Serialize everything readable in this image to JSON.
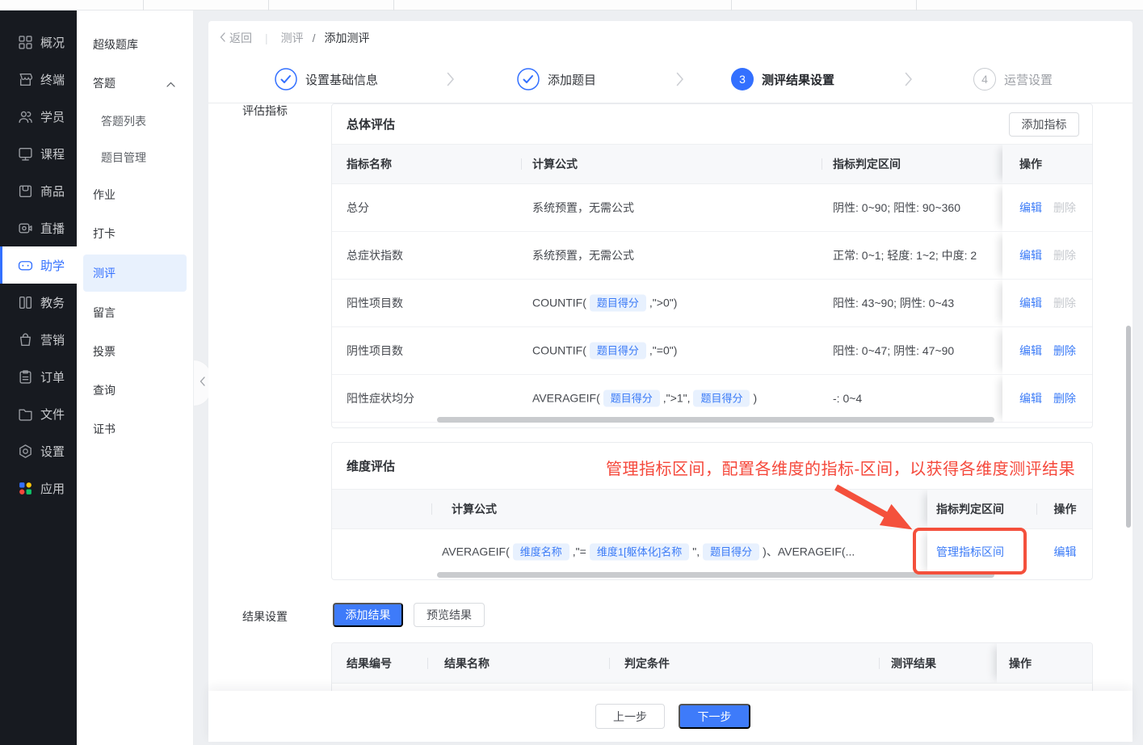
{
  "colors": {
    "accent": "#3370ff",
    "button_blue": "#3e7bfa",
    "annotation_red": "#f4503c",
    "tag_bg": "#e8f1fe",
    "active_item_bg": "#e8f1fd"
  },
  "sidebar": {
    "items": [
      {
        "label": "概况",
        "icon": "grid-icon"
      },
      {
        "label": "终端",
        "icon": "storefront-icon"
      },
      {
        "label": "学员",
        "icon": "users-icon"
      },
      {
        "label": "课程",
        "icon": "monitor-icon"
      },
      {
        "label": "商品",
        "icon": "goods-box-icon"
      },
      {
        "label": "直播",
        "icon": "video-camera-icon"
      },
      {
        "label": "助学",
        "icon": "study-aid-icon",
        "active": true
      },
      {
        "label": "教务",
        "icon": "academic-icon"
      },
      {
        "label": "营销",
        "icon": "marketing-bag-icon"
      },
      {
        "label": "订单",
        "icon": "order-clipboard-icon"
      },
      {
        "label": "文件",
        "icon": "folder-icon"
      },
      {
        "label": "设置",
        "icon": "gear-icon"
      },
      {
        "label": "应用",
        "icon": "apps-icon"
      }
    ]
  },
  "submenu": {
    "items": [
      {
        "label": "超级题库"
      },
      {
        "label": "答题",
        "expanded": true
      },
      {
        "label": "答题列表",
        "child": true
      },
      {
        "label": "题目管理",
        "child": true
      },
      {
        "label": "作业"
      },
      {
        "label": "打卡"
      },
      {
        "label": "测评",
        "active": true
      },
      {
        "label": "留言"
      },
      {
        "label": "投票"
      },
      {
        "label": "查询"
      },
      {
        "label": "证书"
      }
    ]
  },
  "breadcrumb": {
    "back": "返回",
    "divider": "|",
    "section": "测评",
    "slash": "/",
    "current": "添加测评"
  },
  "steps": [
    {
      "label": "设置基础信息",
      "state": "done"
    },
    {
      "label": "添加题目",
      "state": "done"
    },
    {
      "number": "3",
      "label": "测评结果设置",
      "state": "active"
    },
    {
      "number": "4",
      "label": "运营设置",
      "state": "todo"
    }
  ],
  "panel": {
    "eval_label": "评估指标",
    "overall": {
      "title": "总体评估",
      "add_button": "添加指标",
      "headers": {
        "name": "指标名称",
        "formula": "计算公式",
        "range": "指标判定区间",
        "action": "操作"
      },
      "rows": [
        {
          "name": "总分",
          "f0": "系统预置，无需公式",
          "range": "阴性: 0~90; 阳性: 90~360",
          "edit": "编辑",
          "delete": "删除",
          "delete_disabled": true
        },
        {
          "name": "总症状指数",
          "f0": "系统预置，无需公式",
          "range": "正常: 0~1; 轻度: 1~2; 中度: 2",
          "edit": "编辑",
          "delete": "删除",
          "delete_disabled": true
        },
        {
          "name": "阳性项目数",
          "f0": "COUNTIF(",
          "tag0": "题目得分",
          "f1": ",\">0\")",
          "range": "阳性: 43~90; 阴性: 0~43",
          "edit": "编辑",
          "delete": "删除",
          "delete_disabled": true
        },
        {
          "name": "阴性项目数",
          "f0": "COUNTIF(",
          "tag0": "题目得分",
          "f1": ",\"=0\")",
          "range": "阳性: 0~47; 阴性: 47~90",
          "edit": "编辑",
          "delete": "删除",
          "delete_disabled": false
        },
        {
          "name": "阳性症状均分",
          "f0": "AVERAGEIF(",
          "tag0": "题目得分",
          "f1": ",\">1\",",
          "tag1": "题目得分",
          "f2": ")",
          "range": "-: 0~4",
          "edit": "编辑",
          "delete": "删除",
          "delete_disabled": false
        }
      ]
    },
    "dimension": {
      "title": "维度评估",
      "annotation": "管理指标区间，配置各维度的指标-区间，以获得各维度测评结果",
      "headers": {
        "formula": "计算公式",
        "range": "指标判定区间",
        "action": "操作"
      },
      "row": {
        "f0": "AVERAGEIF(",
        "tag0": "维度名称",
        "f1": ",\"=",
        "tag1": "维度1[躯体化]名称",
        "f2": "\",",
        "tag2": "题目得分",
        "f3": ")、AVERAGEIF(...",
        "manage": "管理指标区间",
        "edit": "编辑"
      }
    },
    "result": {
      "label": "结果设置",
      "add_button": "添加结果",
      "preview_button": "预览结果",
      "headers": {
        "no": "结果编号",
        "name": "结果名称",
        "condition": "判定条件",
        "result": "测评结果",
        "action": "操作"
      }
    }
  },
  "footer": {
    "prev": "上一步",
    "next": "下一步"
  }
}
